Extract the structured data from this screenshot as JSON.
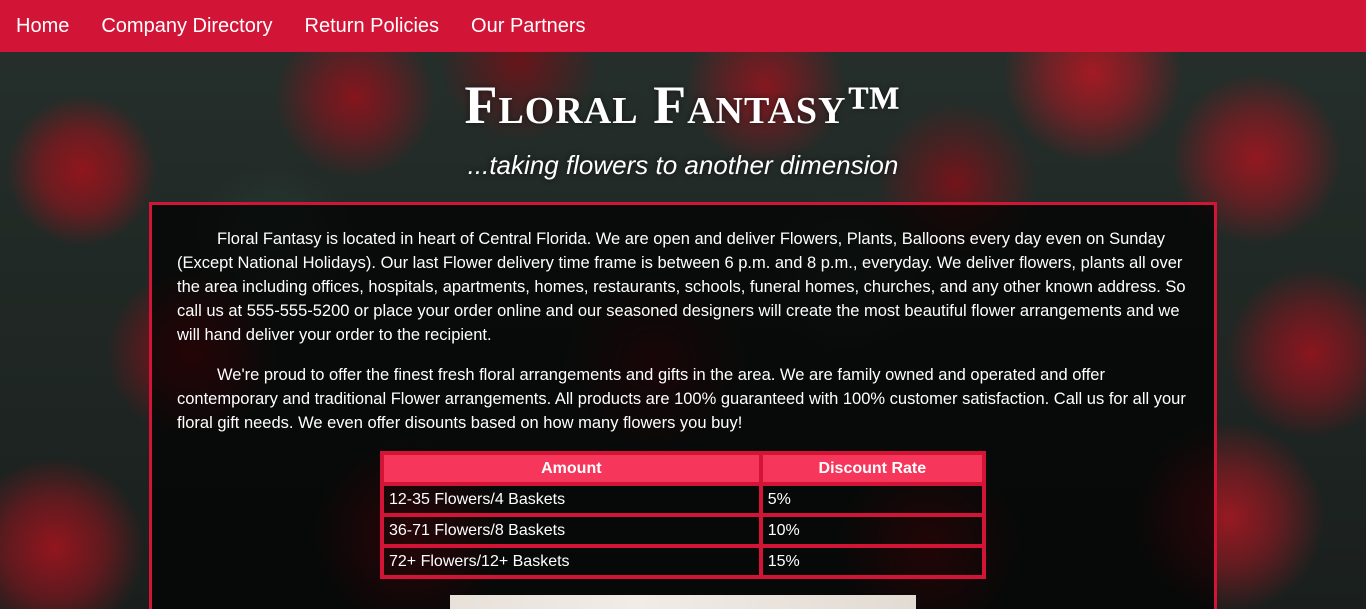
{
  "nav": {
    "items": [
      {
        "label": "Home"
      },
      {
        "label": "Company Directory"
      },
      {
        "label": "Return Policies"
      },
      {
        "label": "Our Partners"
      }
    ]
  },
  "header": {
    "title": "Floral Fantasy™",
    "tagline": "...taking flowers to another dimension"
  },
  "main": {
    "paragraphs": [
      "Floral Fantasy is located in heart of Central Florida. We are open and deliver Flowers, Plants, Balloons every day even on Sunday (Except National Holidays). Our last Flower delivery time frame is between 6 p.m. and 8 p.m., everyday. We deliver flowers, plants all over the area including offices, hospitals, apartments, homes, restaurants, schools, funeral homes, churches, and any other known address. So call us at 555-555-5200 or place your order online and our seasoned designers will create the most beautiful flower arrangements and we will hand deliver your order to the recipient.",
      "We're proud to offer the finest fresh floral arrangements and gifts in the area. We are family owned and operated and offer contemporary and traditional Flower arrangements. All products are 100% guaranteed with 100% customer satisfaction. Call us for all your floral gift needs. We even offer disounts based on how many flowers you buy!"
    ],
    "table": {
      "headers": [
        "Amount",
        "Discount Rate"
      ],
      "rows": [
        [
          "12-35 Flowers/4 Baskets",
          "5%"
        ],
        [
          "36-71 Flowers/8 Baskets",
          "10%"
        ],
        [
          "72+ Flowers/12+ Baskets",
          "15%"
        ]
      ]
    }
  },
  "colors": {
    "accent": "#d21537",
    "table_header": "#f6365a",
    "text": "#ffffff"
  }
}
